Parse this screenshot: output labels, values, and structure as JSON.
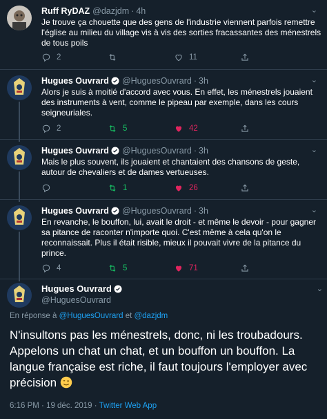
{
  "tweets": [
    {
      "name": "Ruff RyDAZ",
      "handle": "@dazjdm",
      "time": "4h",
      "verified": false,
      "text": "Je trouve ça chouette que des gens de l'industrie viennent parfois remettre l'église au milieu du village vis à vis des sorties fracassantes des ménestrels de tous poils",
      "replies": "2",
      "retweets": "",
      "likes": "11",
      "rt_active": false,
      "like_active": false
    },
    {
      "name": "Hugues Ouvrard",
      "handle": "@HuguesOuvrard",
      "time": "3h",
      "verified": true,
      "text": "Alors je suis à moitié d'accord avec vous. En effet, les ménestrels jouaient des instruments à vent, comme le pipeau par exemple, dans les cours seigneuriales.",
      "replies": "2",
      "retweets": "5",
      "likes": "42",
      "rt_active": true,
      "like_active": true
    },
    {
      "name": "Hugues Ouvrard",
      "handle": "@HuguesOuvrard",
      "time": "3h",
      "verified": true,
      "text": "Mais le plus souvent, ils jouaient et chantaient des chansons de geste, autour de chevaliers et de dames vertueuses.",
      "replies": "",
      "retweets": "1",
      "likes": "26",
      "rt_active": true,
      "like_active": true
    },
    {
      "name": "Hugues Ouvrard",
      "handle": "@HuguesOuvrard",
      "time": "3h",
      "verified": true,
      "text": "En revanche, le bouffon, lui, avait le droit - et même le devoir - pour gagner sa pitance de raconter n'importe quoi.  C'est même à cela qu'on le reconnaissait. Plus il était risible, mieux il pouvait vivre de la pitance du prince.",
      "replies": "4",
      "retweets": "5",
      "likes": "71",
      "rt_active": true,
      "like_active": true
    }
  ],
  "main": {
    "name": "Hugues Ouvrard",
    "handle": "@HuguesOuvrard",
    "reply_prefix": "En réponse à",
    "reply_user1": "@HuguesOuvrard",
    "reply_and": "et",
    "reply_user2": "@dazjdm",
    "text": "N'insultons pas les ménestrels, donc, ni les troubadours. Appelons un chat un chat, et un bouffon un bouffon. La langue française est riche, il faut toujours l'employer avec précision",
    "timestamp": "6:16 PM · 19 déc. 2019 ·",
    "source": "Twitter Web App"
  },
  "colors": {
    "background": "#15202b",
    "secondary_text": "#8899a6",
    "link": "#1da1f2",
    "retweet_active": "#17bf63",
    "like_active": "#e0245e"
  }
}
